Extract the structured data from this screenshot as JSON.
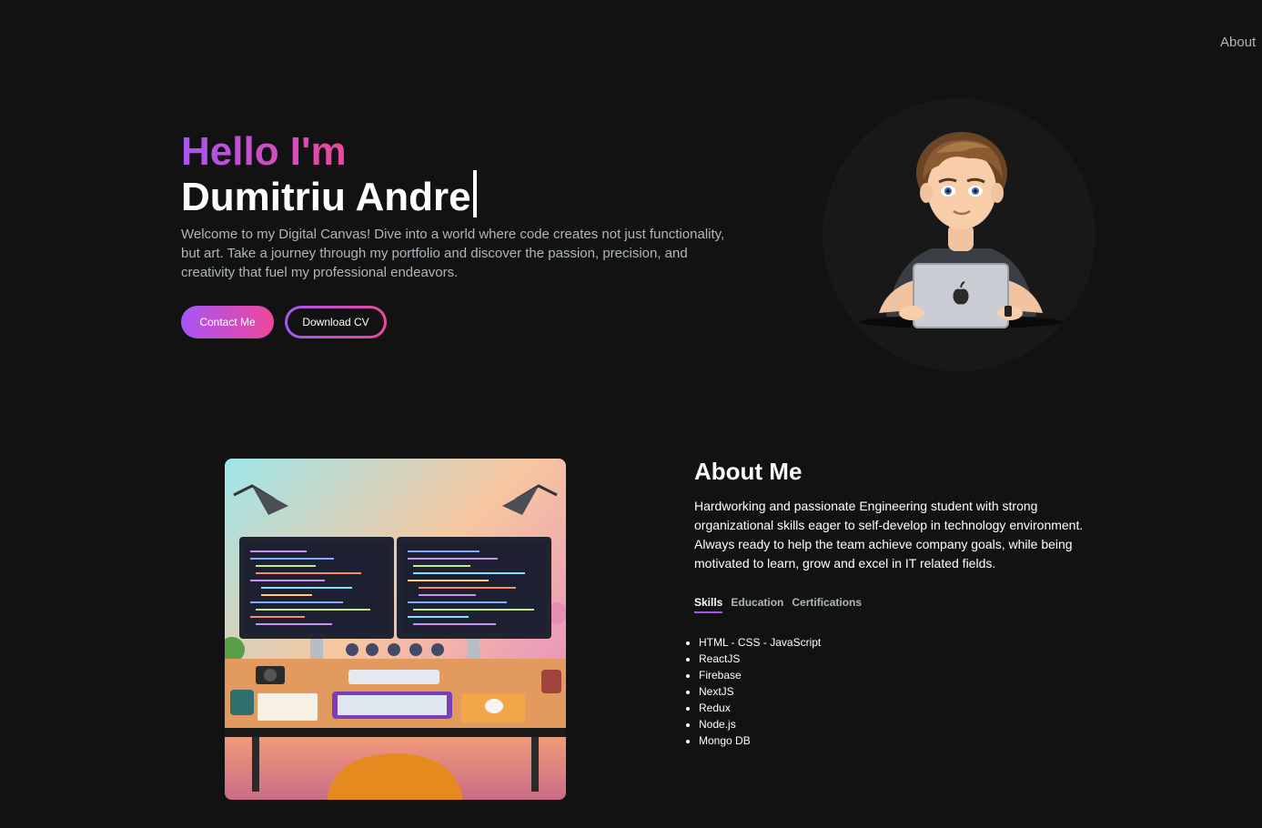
{
  "nav": {
    "about_label": "About"
  },
  "hero": {
    "greeting": "Hello I'm",
    "name": "Dumitriu Andre",
    "description": "Welcome to my Digital Canvas! Dive into a world where code creates not just functionality, but art. Take a journey through my portfolio and discover the passion, precision, and creativity that fuel my professional endeavors.",
    "contact_button": "Contact Me",
    "cv_button": "Download CV"
  },
  "about": {
    "title": "About Me",
    "text": "Hardworking and passionate Engineering student with strong organizational skills eager to self-develop in technology environment. Always ready to help the team achieve company goals, while being motivated to learn, grow and excel in IT related fields.",
    "tabs": [
      "Skills",
      "Education",
      "Certifications"
    ],
    "active_tab": "Skills",
    "skills": [
      "HTML - CSS - JavaScript",
      "ReactJS",
      "Firebase",
      "NextJS",
      "Redux",
      "Node.js",
      "Mongo DB"
    ]
  },
  "colors": {
    "background": "#121212",
    "accent_start": "#a855f7",
    "accent_end": "#ec4899",
    "muted_text": "#adb7be"
  }
}
